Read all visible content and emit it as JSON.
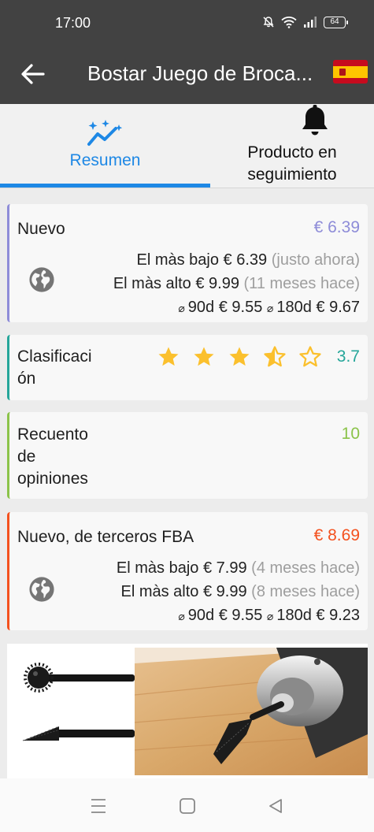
{
  "status_bar": {
    "time": "17:00",
    "battery": "64",
    "icons": [
      "mute-bell-icon",
      "wifi-icon",
      "signal-icon",
      "battery-icon"
    ]
  },
  "app_bar": {
    "title": "Bostar Juego de Broca...",
    "back_icon": "back-arrow-icon",
    "flag_icon": "spain-flag-icon"
  },
  "tabs": [
    {
      "label": "Resumen",
      "icon": "trend-sparkle-icon",
      "active": true
    },
    {
      "label": "Producto en\nseguimiento",
      "icon": "bell-icon",
      "active": false
    }
  ],
  "cards": {
    "new": {
      "title": "Nuevo",
      "value": "€ 6.39",
      "lowest_label": "El màs bajo",
      "lowest_price": "€ 6.39",
      "lowest_when": "(justo ahora)",
      "highest_label": "El màs alto",
      "highest_price": "€ 9.99",
      "highest_when": "(11 meses hace)",
      "avg_90_label": "90d",
      "avg_90_value": "€ 9.55",
      "avg_180_label": "180d",
      "avg_180_value": "€ 9.67",
      "accent": "#8e8cd8"
    },
    "rating": {
      "title": "Clasificaci\nón",
      "value": "3.7",
      "stars": 3.5,
      "accent": "#26a69a"
    },
    "reviews": {
      "title": "Recuento\nde\nopiniones",
      "value": "10",
      "accent": "#8bc34a"
    },
    "fba": {
      "title": "Nuevo, de terceros FBA",
      "value": "€ 8.69",
      "lowest_label": "El màs bajo",
      "lowest_price": "€ 7.99",
      "lowest_when": "(4 meses hace)",
      "highest_label": "El màs alto",
      "highest_price": "€ 9.99",
      "highest_when": "(8 meses hace)",
      "avg_90_label": "90d",
      "avg_90_value": "€ 9.55",
      "avg_180_label": "180d",
      "avg_180_value": "€ 9.23",
      "accent": "#f4511e"
    }
  },
  "avg_symbol": "⌀",
  "nav_bar": {
    "icons": [
      "menu-icon",
      "home-square-icon",
      "back-triangle-icon"
    ]
  }
}
